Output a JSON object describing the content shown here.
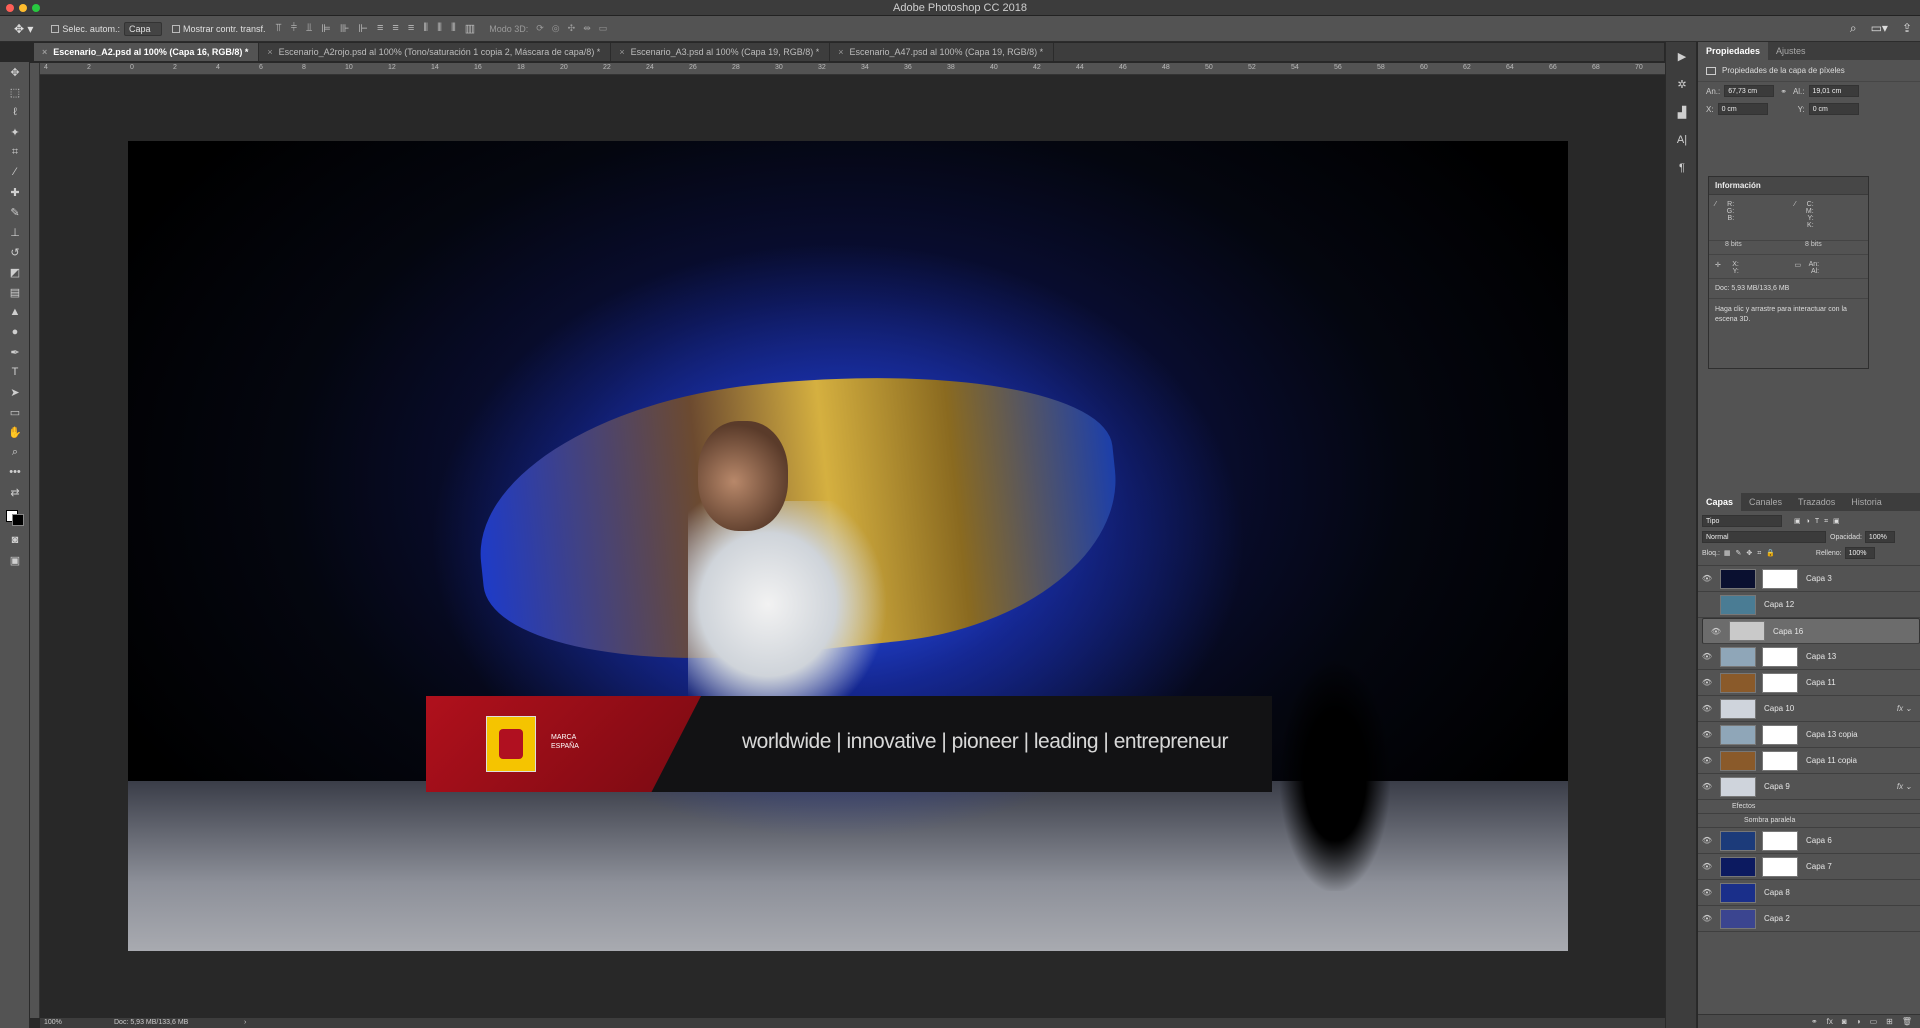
{
  "app": {
    "title": "Adobe Photoshop CC 2018"
  },
  "options_bar": {
    "auto_select_label": "Selec. autom.:",
    "auto_select_value": "Capa",
    "show_transform_label": "Mostrar contr. transf.",
    "mode_3d_label": "Modo 3D:"
  },
  "tabs": [
    {
      "label": "Escenario_A2.psd al 100% (Capa 16, RGB/8) *",
      "active": true
    },
    {
      "label": "Escenario_A2rojo.psd al 100% (Tono/saturación 1 copia 2, Máscara de capa/8) *",
      "active": false
    },
    {
      "label": "Escenario_A3.psd al 100% (Capa 19, RGB/8) *",
      "active": false
    },
    {
      "label": "Escenario_A47.psd al 100% (Capa 19, RGB/8) *",
      "active": false
    }
  ],
  "ruler_ticks": [
    "4",
    "2",
    "0",
    "2",
    "4",
    "6",
    "8",
    "10",
    "12",
    "14",
    "16",
    "18",
    "20",
    "22",
    "24",
    "26",
    "28",
    "30",
    "32",
    "34",
    "36",
    "38",
    "40",
    "42",
    "44",
    "46",
    "48",
    "50",
    "52",
    "54",
    "56",
    "58",
    "60",
    "62",
    "64",
    "66",
    "68",
    "70"
  ],
  "banner": {
    "marca_line1": "MARCA",
    "marca_line2": "ESPAÑA",
    "words": "worldwide | innovative | pioneer | leading | entrepreneur"
  },
  "status": {
    "zoom": "100%",
    "doc": "Doc: 5,93 MB/133,6 MB"
  },
  "properties": {
    "tab_on": "Propiedades",
    "tab_off": "Ajustes",
    "header": "Propiedades de la capa de píxeles",
    "an_label": "An.:",
    "an_value": "67,73 cm",
    "al_label": "Al.:",
    "al_value": "19,01 cm",
    "x_label": "X:",
    "x_value": "0 cm",
    "y_label": "Y:",
    "y_value": "0 cm"
  },
  "info": {
    "title": "Información",
    "rgb_labels": "R:\nG:\nB:",
    "cmyk_labels": "C:\nM:\nY:\nK:",
    "bits_left": "8 bits",
    "bits_right": "8 bits",
    "xy_labels": "X:\nY:",
    "anal_labels": "An:\nAl:",
    "doc": "Doc: 5,93 MB/133,6 MB",
    "hint": "Haga clic y arrastre para interactuar con la escena 3D."
  },
  "layers_panel": {
    "tabs": [
      "Capas",
      "Canales",
      "Trazados",
      "Historia"
    ],
    "filter": "Tipo",
    "blend_mode": "Normal",
    "opacity_label": "Opacidad:",
    "opacity_value": "100%",
    "lock_label": "Bloq.:",
    "fill_label": "Relleno:",
    "fill_value": "100%",
    "layers": [
      {
        "name": "Capa 3",
        "visible": true,
        "mask": true,
        "fx": false,
        "selected": false,
        "thumb": "#0a1030"
      },
      {
        "name": "Capa 12",
        "visible": false,
        "mask": false,
        "fx": false,
        "selected": false,
        "thumb": "#4a7c94"
      },
      {
        "name": "Capa 16",
        "visible": true,
        "mask": false,
        "fx": false,
        "selected": true,
        "thumb": "#c9c9c9"
      },
      {
        "name": "Capa 13",
        "visible": true,
        "mask": true,
        "fx": false,
        "selected": false,
        "thumb": "#8fa6b8"
      },
      {
        "name": "Capa 11",
        "visible": true,
        "mask": true,
        "fx": false,
        "selected": false,
        "thumb": "#8a5a2a"
      },
      {
        "name": "Capa 10",
        "visible": true,
        "mask": false,
        "fx": true,
        "selected": false,
        "thumb": "#cfd4dc"
      },
      {
        "name": "Capa 13 copia",
        "visible": true,
        "mask": true,
        "fx": false,
        "selected": false,
        "thumb": "#8fa6b8"
      },
      {
        "name": "Capa 11 copia",
        "visible": true,
        "mask": true,
        "fx": false,
        "selected": false,
        "thumb": "#8a5a2a"
      },
      {
        "name": "Capa 9",
        "visible": true,
        "mask": false,
        "fx": true,
        "selected": false,
        "thumb": "#cfd4dc"
      }
    ],
    "effects_label": "Efectos",
    "effect_item": "Sombra paralela",
    "layers_bottom": [
      {
        "name": "Capa 6",
        "visible": true,
        "mask": true,
        "thumb": "#1c3b7a"
      },
      {
        "name": "Capa 7",
        "visible": true,
        "mask": true,
        "thumb": "#0c1a60"
      },
      {
        "name": "Capa 8",
        "visible": true,
        "mask": false,
        "thumb": "#1a2f8a"
      },
      {
        "name": "Capa 2",
        "visible": true,
        "mask": false,
        "thumb": "#3b4590"
      }
    ]
  },
  "colors": {
    "accent_red": "#b0101c",
    "flag_yellow": "#f5c400",
    "scene_blue": "#2b57ff"
  }
}
